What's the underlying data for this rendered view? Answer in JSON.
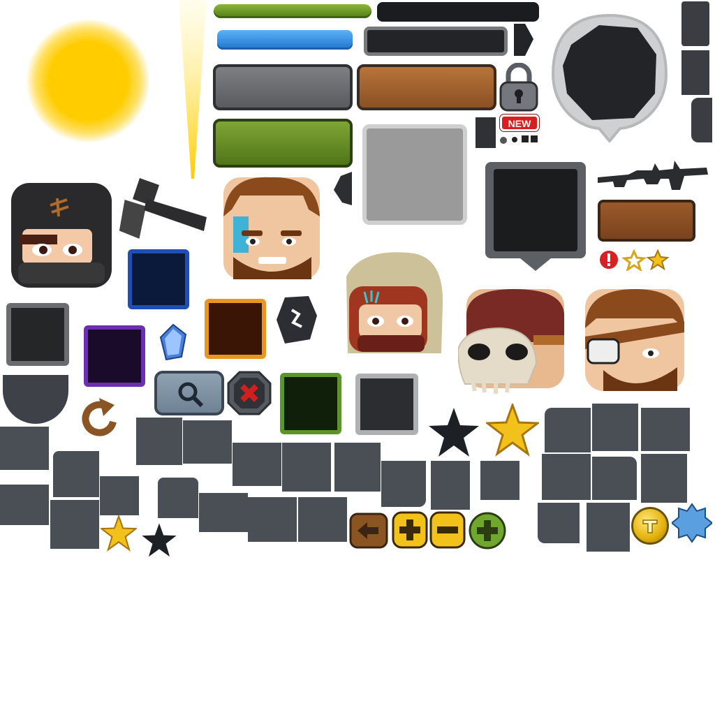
{
  "sprite_sheet": {
    "badges": {
      "new_label": "NEW"
    },
    "icon_names": [
      "sun-glow-icon",
      "light-beam-icon",
      "lock-icon",
      "speech-bubble-icon",
      "hammer-icon",
      "gem-icon",
      "rune-icon",
      "refresh-arrow-icon",
      "search-icon",
      "close-x-icon",
      "back-arrow-icon",
      "plus-icon",
      "minus-icon",
      "add-green-icon",
      "coin-icon",
      "star-gold-icon",
      "star-dark-icon",
      "alert-icon",
      "star-outline-icon",
      "blue-seal-icon",
      "gun-icon"
    ],
    "colors": {
      "health_green": "#6a9a24",
      "mana_blue": "#3a92e6",
      "gold": "#f2c21b",
      "panel_dark": "#1e2023",
      "stone": "#4a4f56",
      "badge_red": "#d81f1f"
    },
    "characters": [
      {
        "id": "ninja",
        "hair": "#262628"
      },
      {
        "id": "hero-warpaint",
        "hair": "#8a4a1c"
      },
      {
        "id": "hooded-rogue",
        "hood": "#c9bd97"
      },
      {
        "id": "skull-pirate",
        "bandana": "#7a2a24"
      },
      {
        "id": "eyepatch-brawler",
        "hair": "#8a4a1c"
      }
    ]
  }
}
